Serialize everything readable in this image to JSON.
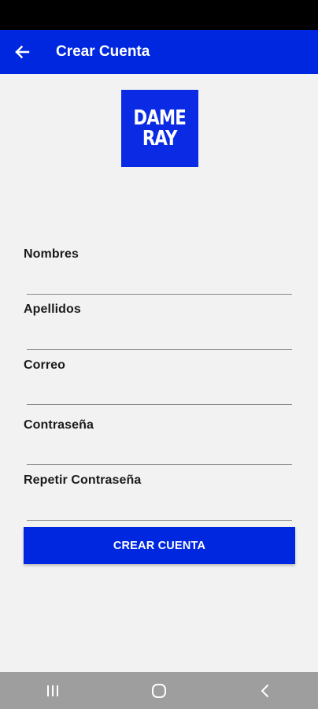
{
  "app_bar": {
    "title": "Crear Cuenta",
    "color": "#0027e0"
  },
  "logo": {
    "line1": "DAME",
    "line2": "RAY"
  },
  "form": {
    "fields": [
      {
        "label": "Nombres",
        "value": ""
      },
      {
        "label": "Apellidos",
        "value": ""
      },
      {
        "label": "Correo",
        "value": ""
      },
      {
        "label": "Contraseña",
        "value": ""
      },
      {
        "label": "Repetir Contraseña",
        "value": ""
      }
    ],
    "submit_label": "CREAR CUENTA"
  },
  "icons": {
    "back": "arrow-back-icon",
    "recents": "recent-apps-icon",
    "home": "home-icon",
    "nav_back": "chevron-left-icon"
  }
}
